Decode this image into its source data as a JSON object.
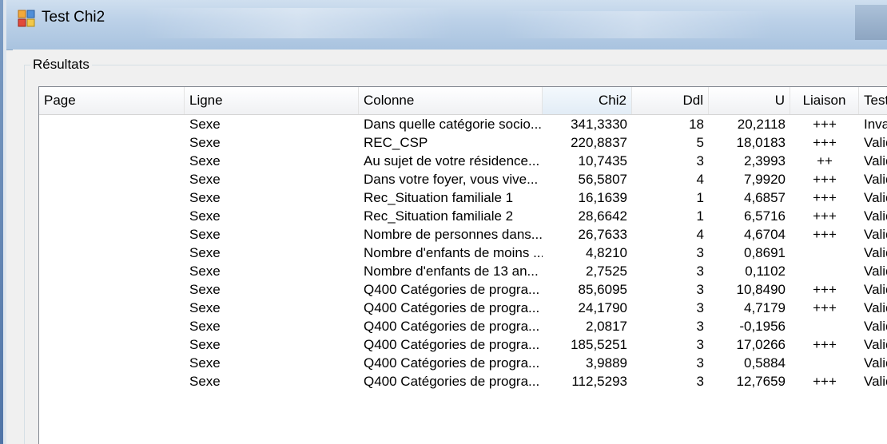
{
  "window": {
    "title": "Test Chi2"
  },
  "group": {
    "label": "Résultats"
  },
  "columns": [
    {
      "key": "page",
      "label": "Page"
    },
    {
      "key": "ligne",
      "label": "Ligne"
    },
    {
      "key": "colonne",
      "label": "Colonne"
    },
    {
      "key": "chi2",
      "label": "Chi2"
    },
    {
      "key": "ddl",
      "label": "Ddl"
    },
    {
      "key": "u",
      "label": "U"
    },
    {
      "key": "liaison",
      "label": "Liaison"
    },
    {
      "key": "test",
      "label": "Test"
    }
  ],
  "rows": [
    {
      "page": "",
      "ligne": "Sexe",
      "colonne": "Dans quelle catégorie socio...",
      "chi2": "341,3330",
      "ddl": "18",
      "u": "20,2118",
      "liaison": "+++",
      "test": "Inval"
    },
    {
      "page": "",
      "ligne": "Sexe",
      "colonne": "REC_CSP",
      "chi2": "220,8837",
      "ddl": "5",
      "u": "18,0183",
      "liaison": "+++",
      "test": "Valid"
    },
    {
      "page": "",
      "ligne": "Sexe",
      "colonne": "Au sujet de votre résidence...",
      "chi2": "10,7435",
      "ddl": "3",
      "u": "2,3993",
      "liaison": "++",
      "test": "Valid"
    },
    {
      "page": "",
      "ligne": "Sexe",
      "colonne": "Dans votre foyer, vous vive...",
      "chi2": "56,5807",
      "ddl": "4",
      "u": "7,9920",
      "liaison": "+++",
      "test": "Valid"
    },
    {
      "page": "",
      "ligne": "Sexe",
      "colonne": "Rec_Situation familiale 1",
      "chi2": "16,1639",
      "ddl": "1",
      "u": "4,6857",
      "liaison": "+++",
      "test": "Valid"
    },
    {
      "page": "",
      "ligne": "Sexe",
      "colonne": "Rec_Situation familiale 2",
      "chi2": "28,6642",
      "ddl": "1",
      "u": "6,5716",
      "liaison": "+++",
      "test": "Valid"
    },
    {
      "page": "",
      "ligne": "Sexe",
      "colonne": "Nombre de personnes dans...",
      "chi2": "26,7633",
      "ddl": "4",
      "u": "4,6704",
      "liaison": "+++",
      "test": "Valid"
    },
    {
      "page": "",
      "ligne": "Sexe",
      "colonne": "Nombre d'enfants de moins ...",
      "chi2": "4,8210",
      "ddl": "3",
      "u": "0,8691",
      "liaison": "",
      "test": "Valid"
    },
    {
      "page": "",
      "ligne": "Sexe",
      "colonne": "Nombre d'enfants de  13 an...",
      "chi2": "2,7525",
      "ddl": "3",
      "u": "0,1102",
      "liaison": "",
      "test": "Valid"
    },
    {
      "page": "",
      "ligne": "Sexe",
      "colonne": "Q400  Catégories de progra...",
      "chi2": "85,6095",
      "ddl": "3",
      "u": "10,8490",
      "liaison": "+++",
      "test": "Valid"
    },
    {
      "page": "",
      "ligne": "Sexe",
      "colonne": "Q400  Catégories de progra...",
      "chi2": "24,1790",
      "ddl": "3",
      "u": "4,7179",
      "liaison": "+++",
      "test": "Valid"
    },
    {
      "page": "",
      "ligne": "Sexe",
      "colonne": "Q400  Catégories de progra...",
      "chi2": "2,0817",
      "ddl": "3",
      "u": "-0,1956",
      "liaison": "",
      "test": "Valid"
    },
    {
      "page": "",
      "ligne": "Sexe",
      "colonne": "Q400  Catégories de progra...",
      "chi2": "185,5251",
      "ddl": "3",
      "u": "17,0266",
      "liaison": "+++",
      "test": "Valid"
    },
    {
      "page": "",
      "ligne": "Sexe",
      "colonne": "Q400  Catégories de progra...",
      "chi2": "3,9889",
      "ddl": "3",
      "u": "0,5884",
      "liaison": "",
      "test": "Valid"
    },
    {
      "page": "",
      "ligne": "Sexe",
      "colonne": "Q400  Catégories de progra...",
      "chi2": "112,5293",
      "ddl": "3",
      "u": "12,7659",
      "liaison": "+++",
      "test": "Valid"
    }
  ]
}
